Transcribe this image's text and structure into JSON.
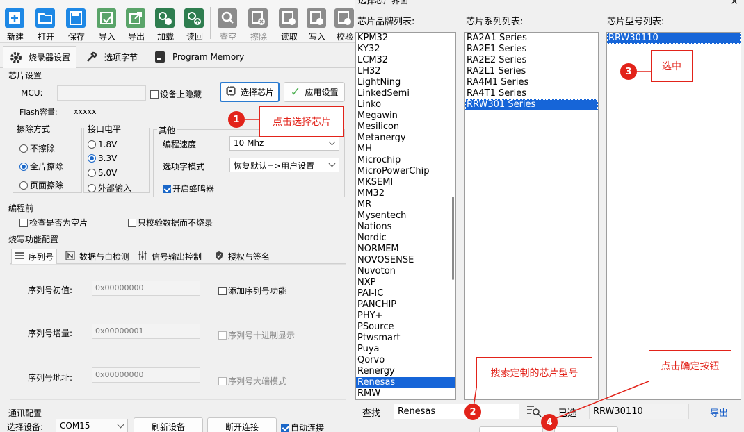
{
  "toolbar": {
    "new": "新建",
    "open": "打开",
    "save": "保存",
    "import": "导入",
    "export": "导出",
    "load": "加载",
    "read_back": "读回",
    "blank_check": "查空",
    "erase": "擦除",
    "read": "读取",
    "write": "写入",
    "verify": "校验"
  },
  "tabs": {
    "programmer": "烧录器设置",
    "option_bytes": "选项字节",
    "program_memory": "Program Memory"
  },
  "chip_settings": {
    "title": "芯片设置",
    "mcu_label": "MCU:",
    "mcu_value": "",
    "hide_on_device": "设备上隐藏",
    "select_chip": "选择芯片",
    "apply_settings": "应用设置",
    "flash_label": "Flash容量:",
    "flash_value": "xxxxx"
  },
  "erase_mode": {
    "title": "擦除方式",
    "none": "不擦除",
    "full": "全片擦除",
    "page": "页面擦除",
    "selected": "full"
  },
  "io_level": {
    "title": "接口电平",
    "v18": "1.8V",
    "v33": "3.3V",
    "v50": "5.0V",
    "external": "外部输入",
    "selected": "v33"
  },
  "other": {
    "title": "其他",
    "speed_label": "编程速度",
    "speed_value": "10 Mhz",
    "option_mode_label": "选项字模式",
    "option_mode_value": "恢复默认=>用户设置",
    "buzzer": "开启蜂鸣器",
    "buzzer_checked": true
  },
  "pre_program": {
    "title": "编程前",
    "blank_check": "检查是否为空片",
    "verify_only": "只校验数据而不烧录"
  },
  "burn_config": {
    "title": "烧写功能配置",
    "subtabs": [
      "序列号",
      "数据与自检测",
      "信号输出控制",
      "授权与签名"
    ],
    "serial_init_label": "序列号初值:",
    "serial_init_value": "0x00000000",
    "serial_inc_label": "序列号增量:",
    "serial_inc_value": "0x00000001",
    "serial_addr_label": "序列号地址:",
    "serial_addr_value": "0x00000000",
    "add_serial": "添加序列号功能",
    "decimal_display": "序列号十进制显示",
    "big_endian": "序列号大端模式"
  },
  "comm": {
    "title": "通讯配置",
    "device_label": "选择设备:",
    "device_value": "COM15",
    "refresh": "刷新设备",
    "disconnect": "断开连接",
    "auto_connect": "自动连接"
  },
  "dialog": {
    "title": "选择芯片界面",
    "close": "×",
    "brand_title": "芯片品牌列表:",
    "series_title": "芯片系列列表:",
    "model_title": "芯片型号列表:",
    "brands": [
      "KPM32",
      "KY32",
      "LCM32",
      "LH32",
      "LightNing",
      "LinkedSemi",
      "Linko",
      "Megawin",
      "Mesilicon",
      "Metanergy",
      "MH",
      "Microchip",
      "MicroPowerChip",
      "MKSEMI",
      "MM32",
      "MR",
      "Mysentech",
      "Nations",
      "Nordic",
      "NORMEM",
      "NOVOSENSE",
      "Nuvoton",
      "NXP",
      "PAI-IC",
      "PANCHIP",
      "PHY+",
      "PSource",
      "Ptwsmart",
      "Puya",
      "Qorvo",
      "Renergy",
      "Renesas",
      "RMW"
    ],
    "selected_brand": "Renesas",
    "series": [
      "RA2A1 Series",
      "RA2E1 Series",
      "RA2E2 Series",
      "RA2L1 Series",
      "RA4M1 Series",
      "RA4T1 Series",
      "RRW301 Series"
    ],
    "selected_series": "RRW301 Series",
    "models": [
      "RRW30110"
    ],
    "selected_model": "RRW30110",
    "find_label": "查找",
    "find_value": "Renesas",
    "selected_label": "已选",
    "selected_value": "RRW30110",
    "export": "导出"
  },
  "annotations": {
    "a1_num": "1",
    "a1_text": "点击选择芯片",
    "a2_num": "2",
    "a2_text": "搜索定制的芯片型号",
    "a3_num": "3",
    "a3_text": "选中",
    "a4_num": "4",
    "a4_text": "点击确定按钮"
  },
  "colors": {
    "accent": "#1665d8",
    "annotation_red": "#e2231a"
  }
}
